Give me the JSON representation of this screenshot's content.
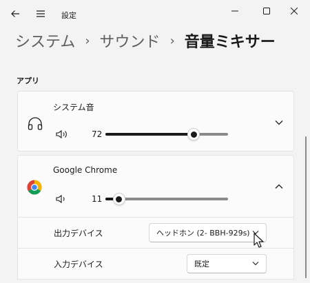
{
  "window": {
    "title": "設定"
  },
  "breadcrumb": {
    "items": [
      "システム",
      "サウンド",
      "音量ミキサー"
    ],
    "separator": "›"
  },
  "section": {
    "apps_label": "アプリ"
  },
  "apps": [
    {
      "name": "システム音",
      "icon": "headphones-icon",
      "volume": 72,
      "volume_text": "72",
      "expanded": false
    },
    {
      "name": "Google Chrome",
      "icon": "chrome-icon",
      "volume": 11,
      "volume_text": "11",
      "expanded": true,
      "output_device_label": "出力デバイス",
      "output_device_value": "ヘッドホン (2- BBH-929s)",
      "input_device_label": "入力デバイス",
      "input_device_value": "既定"
    }
  ],
  "colors": {
    "background": "#f3f3f3",
    "card": "#fbfbfb",
    "text": "#1a1a1a",
    "slider_fill": "#1a1a1a",
    "slider_track": "#8a8a8a"
  }
}
